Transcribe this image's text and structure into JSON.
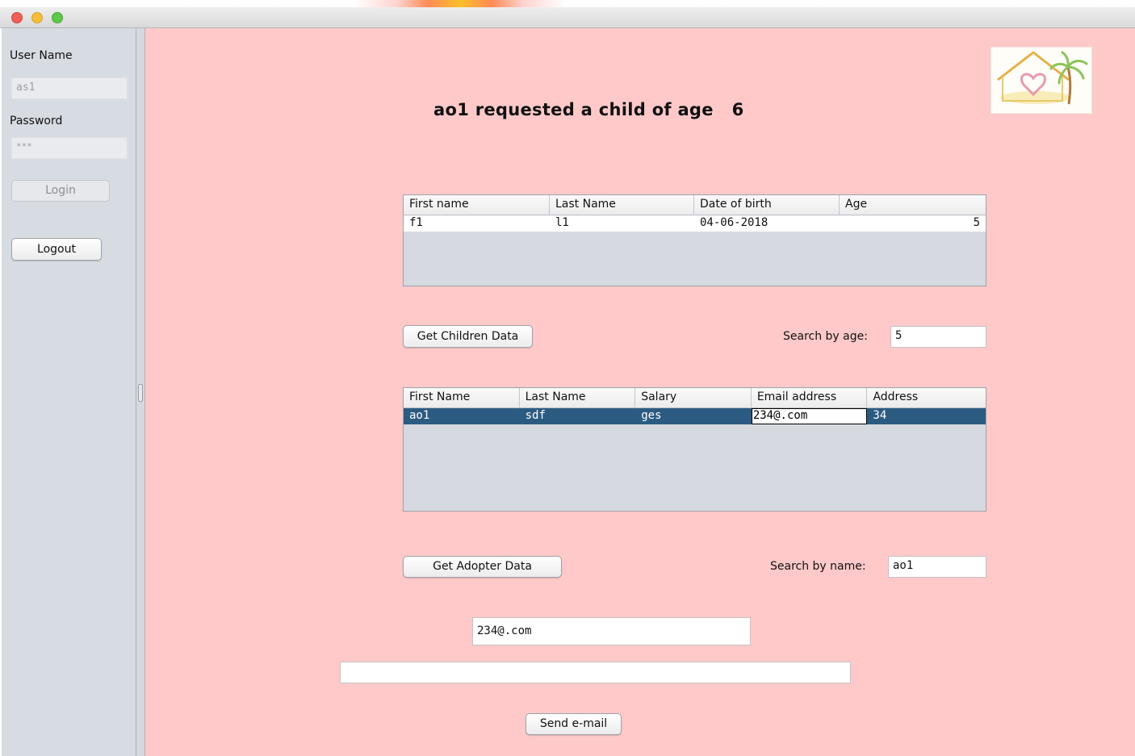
{
  "window": {
    "traffic_lights": [
      "#ee5f57",
      "#f6bd3b",
      "#5fc84b"
    ]
  },
  "sidebar": {
    "username_label": "User Name",
    "username_value": "as1",
    "password_label": "Password",
    "password_value": "***",
    "login_button": "Login",
    "logout_button": "Logout"
  },
  "main": {
    "heading": "ao1 requested a child of age   6",
    "children_table": {
      "headers": [
        "First name",
        "Last Name",
        "Date of birth",
        "Age"
      ],
      "rows": [
        [
          "f1",
          "l1",
          "04-06-2018",
          "5"
        ]
      ]
    },
    "get_children_button": "Get Children Data",
    "search_age_label": "Search by age:",
    "search_age_value": "5",
    "adopter_table": {
      "headers": [
        "First Name",
        "Last Name",
        "Salary",
        "Email address",
        "Address"
      ],
      "rows": [
        [
          "ao1",
          "sdf",
          "ges",
          "234@.com",
          "34"
        ]
      ]
    },
    "get_adopter_button": "Get Adopter Data",
    "search_name_label": "Search by name:",
    "search_name_value": "ao1",
    "email_to_value": "234@.com",
    "message_value": "",
    "send_button": "Send e-mail"
  },
  "colors": {
    "background": "#ffc9c9",
    "sidebar": "#d7dbe2",
    "selected_row": "#2c5b82"
  }
}
